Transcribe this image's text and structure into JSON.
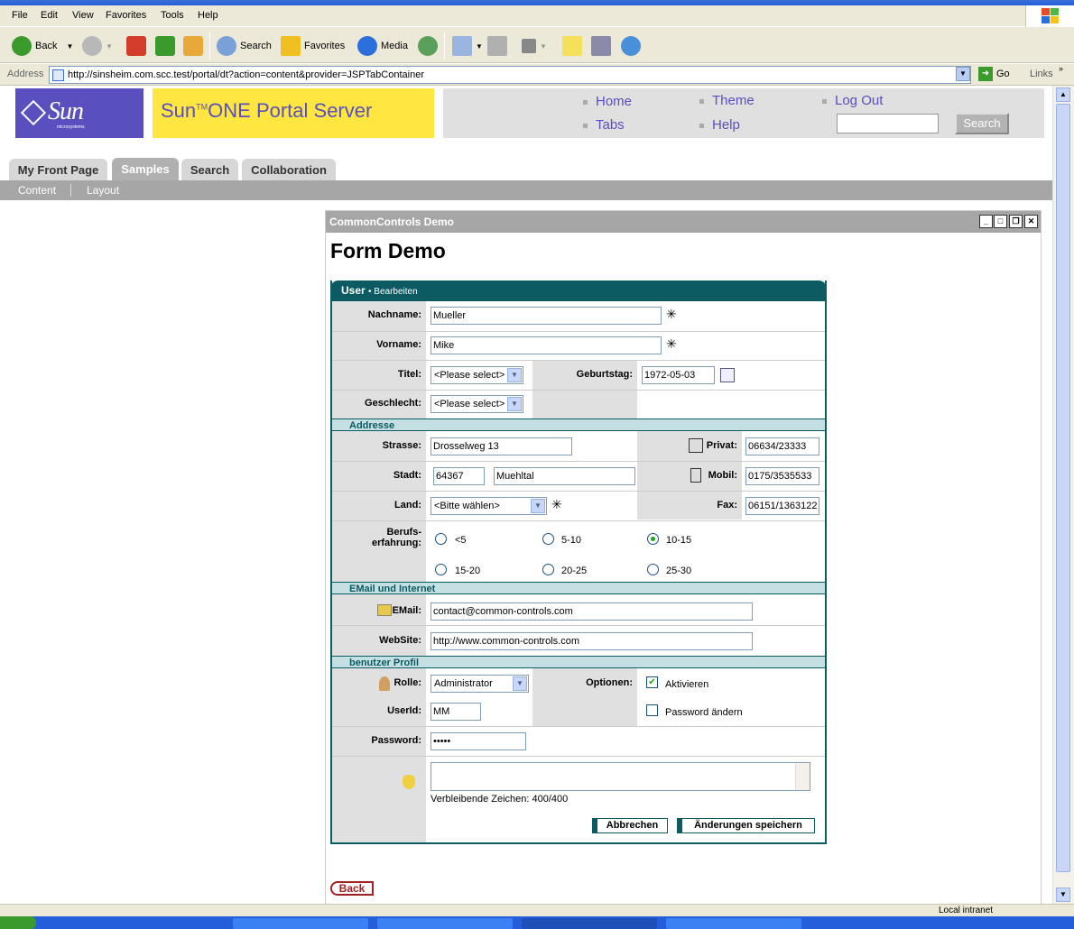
{
  "browser": {
    "menu": [
      "File",
      "Edit",
      "View",
      "Favorites",
      "Tools",
      "Help"
    ],
    "toolbar": {
      "back": "Back",
      "search": "Search",
      "favorites": "Favorites",
      "media": "Media"
    },
    "address_label": "Address",
    "url": "http://sinsheim.com.scc.test/portal/dt?action=content&provider=JSPTabContainer",
    "go": "Go",
    "links": "Links",
    "status_zone": "Local intranet"
  },
  "portal": {
    "logo_text": "Sun",
    "logo_sub": "microsystems",
    "title_a": "Sun",
    "title_tm": "TM",
    "title_b": "ONE Portal Server",
    "links": {
      "home": "Home",
      "theme": "Theme",
      "logout": "Log Out",
      "tabs": "Tabs",
      "help": "Help"
    },
    "search_button": "Search",
    "tabs": [
      {
        "label": "My Front Page"
      },
      {
        "label": "Samples"
      },
      {
        "label": "Search"
      },
      {
        "label": "Collaboration"
      }
    ],
    "subnav": [
      "Content",
      "Layout"
    ]
  },
  "channel": {
    "title": "CommonControls Demo",
    "form_title": "Form Demo",
    "header": "User",
    "header_sub": "• Bearbeiten",
    "fields": {
      "nachname_label": "Nachname:",
      "nachname": "Mueller",
      "vorname_label": "Vorname:",
      "vorname": "Mike",
      "titel_label": "Titel:",
      "titel": "<Please select>",
      "geburtstag_label": "Geburtstag:",
      "geburtstag": "1972-05-03",
      "geschlecht_label": "Geschlecht:",
      "geschlecht": "<Please select>"
    },
    "address": {
      "section": "Addresse",
      "strasse_label": "Strasse:",
      "strasse": "Drosselweg 13",
      "privat_label": "Privat:",
      "privat": "06634/23333",
      "stadt_label": "Stadt:",
      "plz": "64367",
      "stadt": "Muehltal",
      "mobil_label": "Mobil:",
      "mobil": "0175/3535533",
      "land_label": "Land:",
      "land": "<Bitte wählen>",
      "fax_label": "Fax:",
      "fax": "06151/1363122",
      "beruf_label1": "Berufs-",
      "beruf_label2": "erfahrung:",
      "options": [
        "<5",
        "5-10",
        "10-15",
        "15-20",
        "20-25",
        "25-30"
      ],
      "selected": "10-15"
    },
    "internet": {
      "section": "EMail und Internet",
      "email_label": "EMail:",
      "email": "contact@common-controls.com",
      "website_label": "WebSite:",
      "website": "http://www.common-controls.com"
    },
    "profile": {
      "section": "benutzer Profil",
      "rolle_label": "Rolle:",
      "rolle": "Administrator",
      "optionen_label": "Optionen:",
      "aktivieren": "Aktivieren",
      "aktivieren_checked": true,
      "passwort_aendern": "Password ändern",
      "passwort_aendern_checked": false,
      "userid_label": "UserId:",
      "userid": "MM",
      "password_label": "Password:",
      "password": "•••••",
      "remaining": "Verbleibende Zeichen: 400/400"
    },
    "buttons": {
      "cancel": "Abbrechen",
      "save": "Änderungen speichern"
    },
    "back": "Back"
  }
}
